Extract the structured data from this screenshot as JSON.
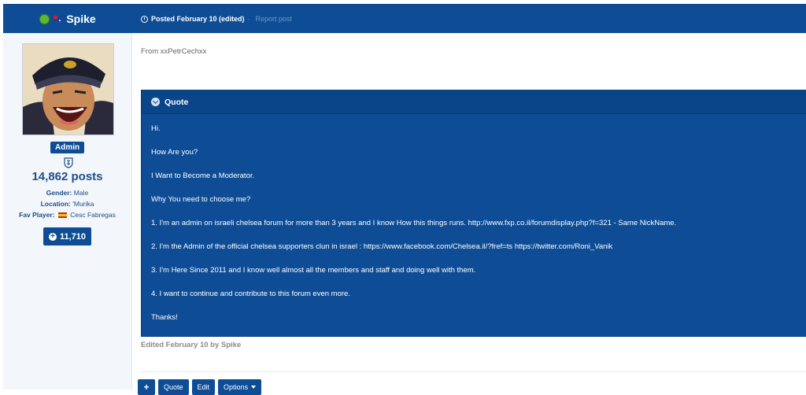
{
  "header": {
    "author_name": "Spike",
    "posted_text": "Posted February 10 (edited)",
    "report_label": "Report post"
  },
  "sidebar": {
    "role": "Admin",
    "post_count": "14,862 posts",
    "fields": [
      {
        "label": "Gender:",
        "value": "Male"
      },
      {
        "label": "Location:",
        "value": "'Murika"
      },
      {
        "label": "Fav Player:",
        "value": "Cesc Fabregas"
      }
    ],
    "reputation": "11,710"
  },
  "post": {
    "from_line": "From xxPetrCechxx",
    "quote_title": "Quote",
    "quote_lines": [
      "Hi.",
      "How Are you?",
      "I Want to Become a Moderator.",
      "Why You need to choose me?",
      "1. I'm an admin on israeli chelsea forum for more than 3 years and I know How this things runs. http://www.fxp.co.il/forumdisplay.php?f=321 - Same NickName.",
      "2. I'm the Admin of the official chelsea supporters clun in israel : https://www.facebook.com/Chelsea.il/?fref=ts  https://twitter.com/Roni_Vanik",
      "3. I'm Here Since 2011 and I know well almost all the members and staff and doing well with them.",
      "4. I want to continue and contribute to this forum even more.",
      "Thanks!"
    ],
    "edited_line": "Edited February 10 by Spike"
  },
  "actions": {
    "plus_label": "+",
    "quote_label": "Quote",
    "edit_label": "Edit",
    "options_label": "Options"
  },
  "icons": {
    "online": "online-status-icon",
    "flag_author": "australia-flag-icon",
    "clock": "clock-icon",
    "rank": "chelsea-crest-icon",
    "flag_player": "spain-flag-icon",
    "reputation": "plus-circle-icon",
    "quote_toggle": "chevron-down-icon",
    "options_caret": "caret-down-icon"
  },
  "colors": {
    "brand": "#0e4d96",
    "online": "#5cb82e",
    "sidebar_bg": "#f3f6fa"
  }
}
